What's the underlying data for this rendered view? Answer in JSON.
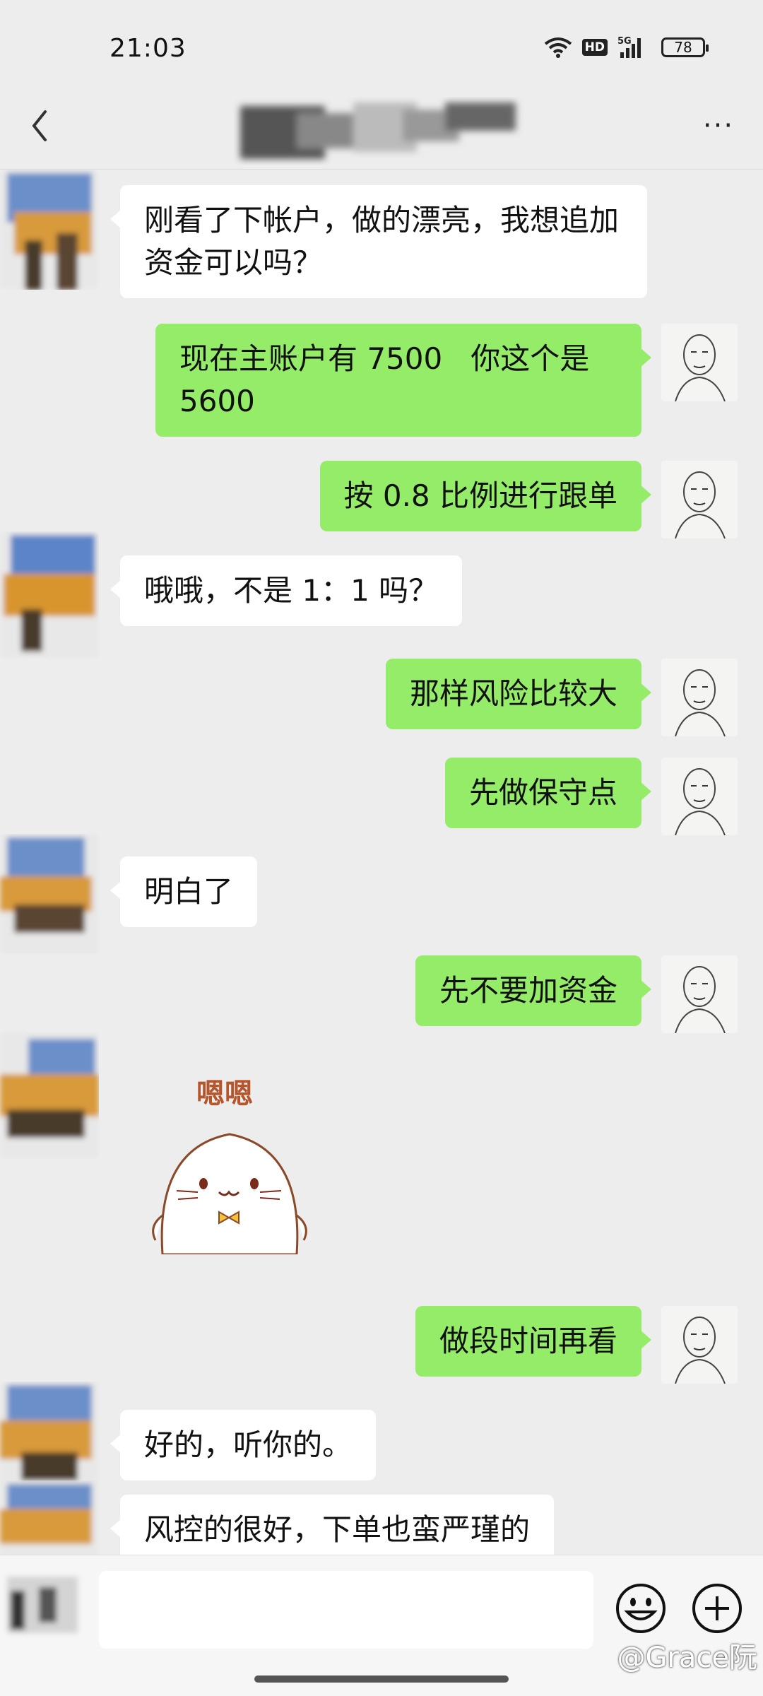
{
  "status_bar": {
    "time": "21:03",
    "network": "5G",
    "hd_label": "HD",
    "battery": "78"
  },
  "header": {
    "back_icon": "chevron-left-icon",
    "more_label": "···"
  },
  "messages": [
    {
      "side": "left",
      "text": "刚看了下帐户，做的漂亮，我想追加资金可以吗？"
    },
    {
      "side": "right",
      "text": "现在主账户有 7500   你这个是 5600"
    },
    {
      "side": "right",
      "text": "按 0.8 比例进行跟单"
    },
    {
      "side": "left",
      "text": "哦哦，不是 1：1 吗？"
    },
    {
      "side": "right",
      "text": "那样风险比较大"
    },
    {
      "side": "right",
      "text": "先做保守点"
    },
    {
      "side": "left",
      "text": "明白了"
    },
    {
      "side": "right",
      "text": "先不要加资金"
    },
    {
      "side": "left",
      "type": "sticker",
      "text": "嗯嗯"
    },
    {
      "side": "right",
      "text": "做段时间再看"
    },
    {
      "side": "left",
      "text": "好的，听你的。"
    },
    {
      "side": "left",
      "text": "风控的很好，下单也蛮严瑾的"
    }
  ],
  "input_bar": {
    "placeholder": "",
    "emoji_icon": "smiley-face-icon",
    "plus_icon": "plus-circle-icon"
  },
  "watermark": "@Grace阮",
  "colors": {
    "background": "#ededed",
    "self_bubble": "#95ec69",
    "other_bubble": "#ffffff"
  }
}
